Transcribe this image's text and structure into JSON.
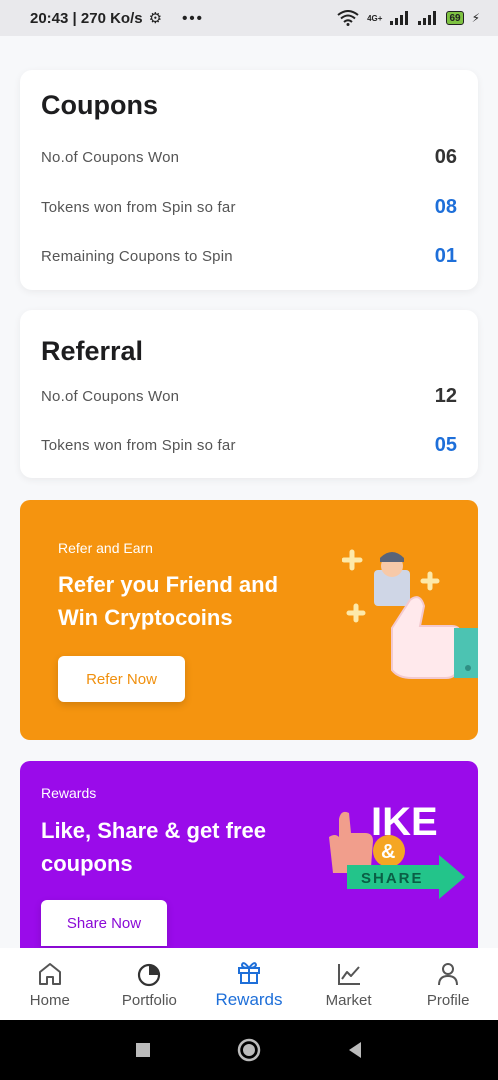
{
  "status_bar": {
    "time_speed": "20:43 | 270 Ko/s",
    "network": "4G+",
    "battery": "69"
  },
  "coupons": {
    "title": "Coupons",
    "rows": [
      {
        "label": "No.of Coupons Won",
        "value": "06"
      },
      {
        "label": "Tokens won from Spin so far",
        "value": "08"
      },
      {
        "label": "Remaining Coupons to Spin",
        "value": "01"
      }
    ]
  },
  "referral": {
    "title": "Referral",
    "rows": [
      {
        "label": "No.of Coupons Won",
        "value": "12"
      },
      {
        "label": "Tokens won from Spin so far",
        "value": "05"
      }
    ]
  },
  "refer_banner": {
    "eyebrow": "Refer and Earn",
    "title_line1": "Refer you Friend and",
    "title_line2": "Win Cryptocoins",
    "button": "Refer Now",
    "bg": "#f5940f"
  },
  "rewards_banner": {
    "eyebrow": "Rewards",
    "title_line1": "Like, Share & get free",
    "title_line2": "coupons",
    "button": "Share Now",
    "art_like": "IKE",
    "art_share": "SHARE",
    "bg": "#9a0bea"
  },
  "nav": [
    {
      "label": "Home",
      "icon": "home-icon"
    },
    {
      "label": "Portfolio",
      "icon": "pie-chart-icon"
    },
    {
      "label": "Rewards",
      "icon": "gift-icon"
    },
    {
      "label": "Market",
      "icon": "line-chart-icon"
    },
    {
      "label": "Profile",
      "icon": "user-icon"
    }
  ],
  "colors": {
    "accent": "#1e6fd9"
  }
}
